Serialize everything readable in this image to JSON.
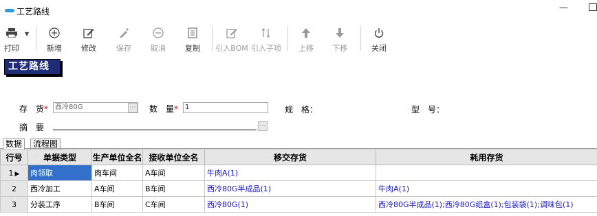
{
  "window": {
    "title": "工艺路线",
    "minimize_glyph": "—"
  },
  "toolbar": {
    "buttons": [
      {
        "label": "打印",
        "icon": "printer-icon",
        "enabled": true
      },
      {
        "label": "新增",
        "icon": "plus-circle-icon",
        "enabled": true
      },
      {
        "label": "修改",
        "icon": "edit-icon",
        "enabled": true
      },
      {
        "label": "保存",
        "icon": "save-icon",
        "enabled": false
      },
      {
        "label": "取消",
        "icon": "minus-circle-icon",
        "enabled": false
      },
      {
        "label": "复制",
        "icon": "copy-icon",
        "enabled": true
      },
      {
        "label": "引入BOM",
        "icon": "import-bom-icon",
        "enabled": false
      },
      {
        "label": "引入子项",
        "icon": "import-subitem-icon",
        "enabled": false
      },
      {
        "label": "上移",
        "icon": "arrow-up-icon",
        "enabled": false
      },
      {
        "label": "下移",
        "icon": "arrow-down-icon",
        "enabled": false
      },
      {
        "label": "关闭",
        "icon": "power-icon",
        "enabled": true
      }
    ]
  },
  "page_heading": "工艺路线",
  "form": {
    "inventory_label": "存　货",
    "inventory_value": "西冷80G",
    "quantity_label": "数　量",
    "quantity_value": "1",
    "spec_label": "规　格：",
    "model_label": "型　号：",
    "summary_label": "摘　要",
    "required_mark": "*"
  },
  "tabs": [
    {
      "label": "数据",
      "active": true
    },
    {
      "label": "流程图",
      "active": false
    }
  ],
  "grid": {
    "columns": [
      "行号",
      "单据类型",
      "生产单位全名",
      "接收单位全名",
      "移交存货",
      "耗用存货"
    ],
    "rows": [
      {
        "row_no": "1",
        "doc_type": "肉领取",
        "producer": "肉车间",
        "receiver": "A车间",
        "transfer": "牛肉A(1)",
        "consume": "",
        "current": true
      },
      {
        "row_no": "2",
        "doc_type": "西冷加工",
        "producer": "A车间",
        "receiver": "B车间",
        "transfer": "西冷80G半成品(1)",
        "consume": "牛肉A(1)",
        "current": false
      },
      {
        "row_no": "3",
        "doc_type": "分装工序",
        "producer": "B车间",
        "receiver": "C车间",
        "transfer": "西冷80G(1)",
        "consume": "西冷80G半成品(1);西冷80G纸盒(1);包装袋(1);调味包(1)",
        "current": false
      }
    ]
  },
  "colors": {
    "heading_bg": "#1f2d79",
    "link_text": "#1414c8",
    "selected_cell": "#3370cc",
    "required_mark": "#dd0000"
  }
}
